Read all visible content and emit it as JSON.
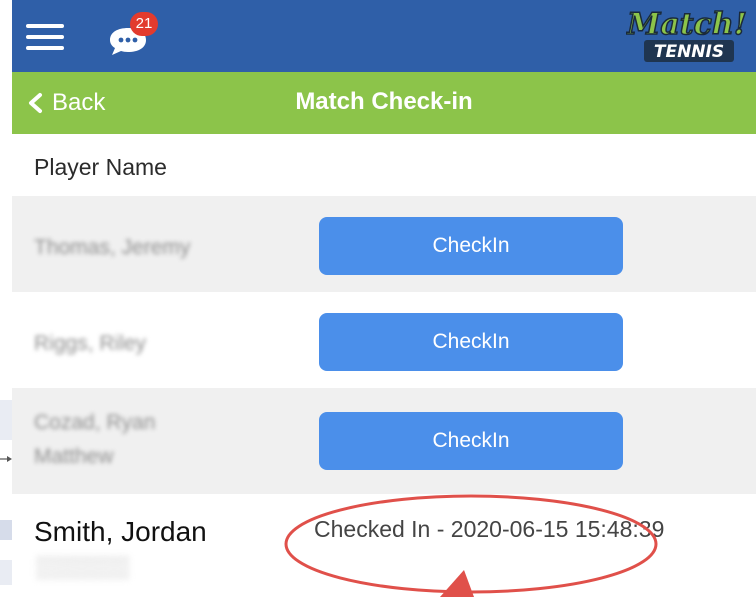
{
  "header": {
    "badge_count": "21",
    "logo_text_top": "Match!",
    "logo_text_bottom": "TENNIS"
  },
  "nav": {
    "back_label": "Back",
    "title": "Match Check-in"
  },
  "table": {
    "column_header": "Player Name",
    "rows": [
      {
        "name": "Thomas, Jeremy",
        "action_label": "CheckIn"
      },
      {
        "name": "Riggs, Riley",
        "action_label": "CheckIn"
      },
      {
        "name": "Cozad, Ryan Matthew",
        "action_label": "CheckIn"
      }
    ],
    "checked_in_row": {
      "name": "Smith, Jordan",
      "status": "Checked In - 2020-06-15 15:48:39"
    }
  },
  "colors": {
    "topbar": "#2f5fa8",
    "navbar": "#8cc44a",
    "button": "#4b8fea",
    "annotation": "#e0504a"
  }
}
